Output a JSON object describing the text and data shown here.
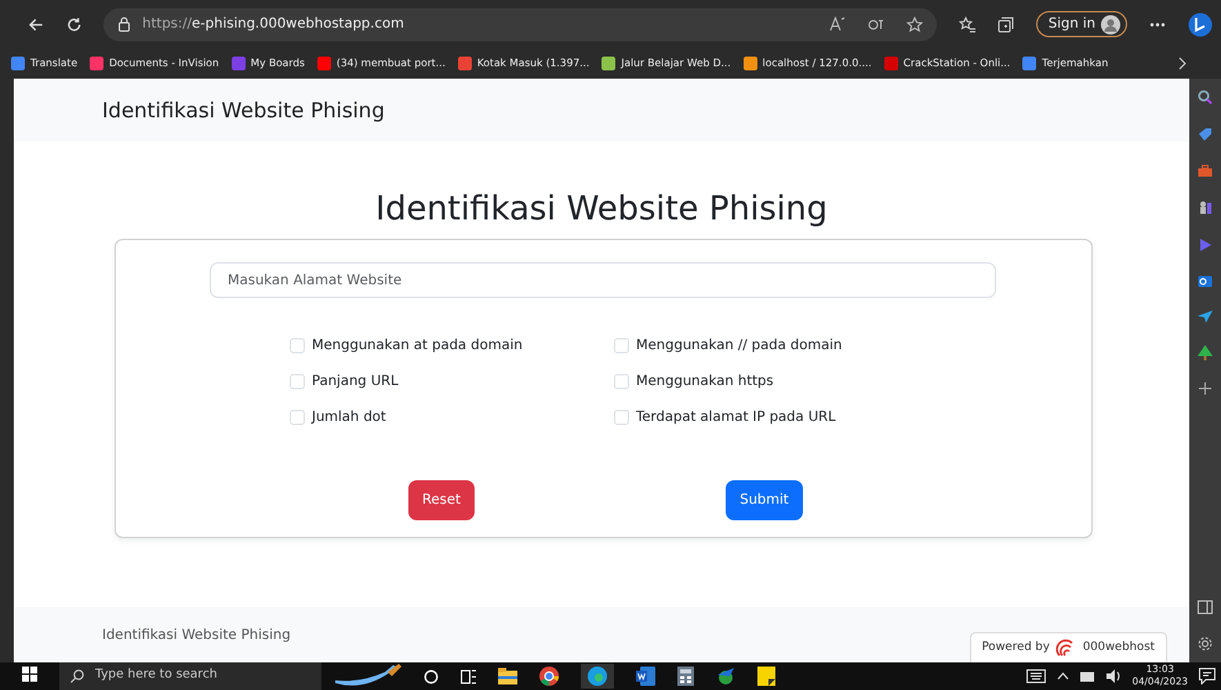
{
  "browser": {
    "url_scheme": "https://",
    "url_host": "e-phising.000webhostapp.com",
    "sign_in": "Sign in",
    "bookmarks": [
      {
        "label": "Translate",
        "color": "#4285f4"
      },
      {
        "label": "Documents - InVision",
        "color": "#ff3366"
      },
      {
        "label": "My Boards",
        "color": "#7b3fe4"
      },
      {
        "label": "(34) membuat port...",
        "color": "#ff0000"
      },
      {
        "label": "Kotak Masuk (1.397...",
        "color": "#ea4335"
      },
      {
        "label": "Jalur Belajar Web D...",
        "color": "#8bc34a"
      },
      {
        "label": "localhost / 127.0.0....",
        "color": "#f29111"
      },
      {
        "label": "CrackStation - Onli...",
        "color": "#d50000"
      },
      {
        "label": "Terjemahkan",
        "color": "#4285f4"
      }
    ]
  },
  "page": {
    "navbar_brand": "Identifikasi Website Phising",
    "heading": "Identifikasi Website Phising",
    "url_field": {
      "placeholder": "Masukan Alamat Website"
    },
    "checkboxes": [
      {
        "label": "Menggunakan at pada domain",
        "checked": false
      },
      {
        "label": "Menggunakan // pada domain",
        "checked": false
      },
      {
        "label": "Panjang URL",
        "checked": false
      },
      {
        "label": "Menggunakan https",
        "checked": false
      },
      {
        "label": "Jumlah dot",
        "checked": false
      },
      {
        "label": "Terdapat alamat IP pada URL",
        "checked": false
      }
    ],
    "buttons": [
      {
        "label": "Reset",
        "kind": "reset"
      },
      {
        "label": "Submit",
        "kind": "submit"
      }
    ],
    "footer_text": "Identifikasi Website Phising",
    "powered_by": {
      "text": "Powered by",
      "brand": "000webhost"
    }
  },
  "taskbar": {
    "search_placeholder": "Type here to search",
    "time": "13:03",
    "date": "04/04/2023"
  }
}
